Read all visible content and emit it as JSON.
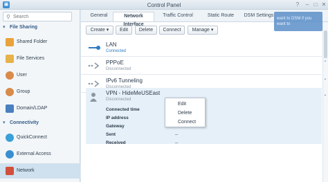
{
  "window": {
    "title": "Control Panel"
  },
  "sidebar": {
    "search_placeholder": "Search",
    "sections": [
      {
        "label": "File Sharing"
      },
      {
        "label": "Connectivity"
      }
    ],
    "items": [
      {
        "label": "Shared Folder",
        "icon": "folder-icon",
        "color": "#e8a33c"
      },
      {
        "label": "File Services",
        "icon": "file-services-icon",
        "color": "#e7b24a"
      },
      {
        "label": "User",
        "icon": "user-icon",
        "color": "#d98b4a"
      },
      {
        "label": "Group",
        "icon": "group-icon",
        "color": "#d98b4a"
      },
      {
        "label": "Domain/LDAP",
        "icon": "domain-icon",
        "color": "#4a7fc0"
      },
      {
        "label": "QuickConnect",
        "icon": "quickconnect-icon",
        "color": "#3aa0d8"
      },
      {
        "label": "External Access",
        "icon": "external-access-icon",
        "color": "#3a8fd0"
      },
      {
        "label": "Network",
        "icon": "network-icon",
        "color": "#d0503c"
      }
    ]
  },
  "tabs": [
    "General",
    "Network Interface",
    "Traffic Control",
    "Static Route",
    "DSM Settings"
  ],
  "toolbar": {
    "create": "Create",
    "edit": "Edit",
    "delete": "Delete",
    "connect": "Connect",
    "manage": "Manage"
  },
  "interfaces": [
    {
      "name": "LAN",
      "status": "Connected",
      "status_color": "#2e7bc4"
    },
    {
      "name": "PPPoE",
      "status": "Disconnected",
      "status_color": "#8a97a3"
    },
    {
      "name": "IPv6 Tunneling",
      "status": "Disconnected",
      "status_color": "#8a97a3"
    }
  ],
  "vpn": {
    "name": "VPN - HideMeUSEast",
    "status": "Disconnected",
    "details": [
      {
        "label": "Connected time",
        "value": ""
      },
      {
        "label": "IP address",
        "value": ""
      },
      {
        "label": "Gateway",
        "value": ""
      },
      {
        "label": "Sent",
        "value": "--"
      },
      {
        "label": "Received",
        "value": "--"
      }
    ]
  },
  "context_menu": [
    "Edit",
    "Delete",
    "Connect"
  ],
  "popup_text": "want to DSM if you want to"
}
